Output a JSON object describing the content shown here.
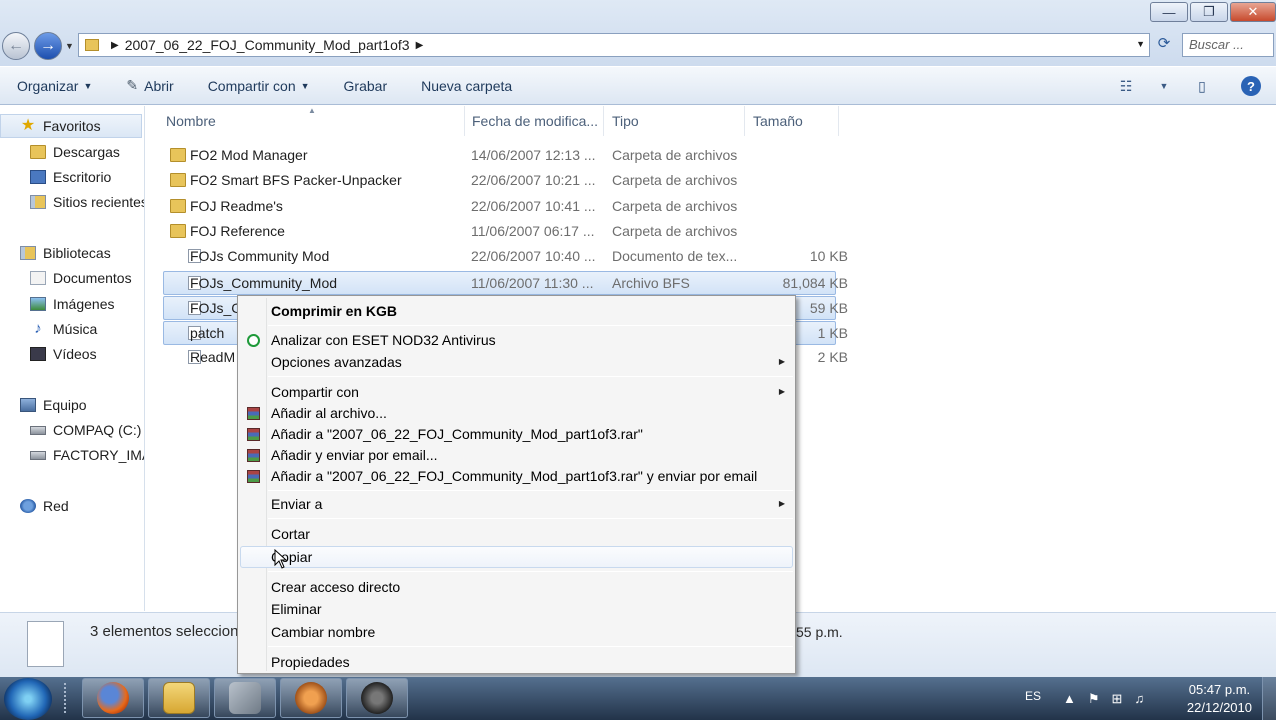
{
  "window": {
    "minimize": "—",
    "maximize": "❐",
    "close": "✕"
  },
  "address": {
    "path": "2007_06_22_FOJ_Community_Mod_part1of3",
    "search_placeholder": "Buscar ..."
  },
  "toolbar": {
    "organize": "Organizar",
    "open": "Abrir",
    "share": "Compartir con",
    "burn": "Grabar",
    "new_folder": "Nueva carpeta"
  },
  "nav": {
    "favorites": "Favoritos",
    "downloads": "Descargas",
    "desktop": "Escritorio",
    "recent": "Sitios recientes",
    "libraries": "Bibliotecas",
    "documents": "Documentos",
    "images": "Imágenes",
    "music": "Música",
    "videos": "Vídeos",
    "computer": "Equipo",
    "drive_c": "COMPAQ (C:)",
    "drive_factory": "FACTORY_IMAGE",
    "network": "Red"
  },
  "columns": {
    "name": "Nombre",
    "date": "Fecha de modifica...",
    "type": "Tipo",
    "size": "Tamaño"
  },
  "files": [
    {
      "name": "FO2 Mod Manager",
      "date": "14/06/2007 12:13 ...",
      "type": "Carpeta de archivos",
      "size": "",
      "kind": "folder",
      "selected": false
    },
    {
      "name": "FO2 Smart BFS Packer-Unpacker",
      "date": "22/06/2007 10:21 ...",
      "type": "Carpeta de archivos",
      "size": "",
      "kind": "folder",
      "selected": false
    },
    {
      "name": "FOJ Readme's",
      "date": "22/06/2007 10:41 ...",
      "type": "Carpeta de archivos",
      "size": "",
      "kind": "folder",
      "selected": false
    },
    {
      "name": "FOJ Reference",
      "date": "11/06/2007 06:17 ...",
      "type": "Carpeta de archivos",
      "size": "",
      "kind": "folder",
      "selected": false
    },
    {
      "name": "FOJs Community Mod",
      "date": "22/06/2007 10:40 ...",
      "type": "Documento de tex...",
      "size": "10 KB",
      "kind": "file",
      "selected": false
    },
    {
      "name": "FOJs_Community_Mod",
      "date": "11/06/2007 11:30 ...",
      "type": "Archivo BFS",
      "size": "81,084 KB",
      "kind": "file",
      "selected": true
    },
    {
      "name": "FOJs_Co",
      "date": "",
      "type": "",
      "size": "59 KB",
      "kind": "file",
      "selected": true
    },
    {
      "name": "patch",
      "date": "",
      "type": "",
      "size": "1 KB",
      "kind": "file",
      "selected": true
    },
    {
      "name": "ReadM",
      "date": "",
      "type": "",
      "size": "2 KB",
      "kind": "file",
      "selected": false
    }
  ],
  "context_menu": {
    "compress": "Comprimir en KGB",
    "eset": "Analizar con ESET NOD32 Antivirus",
    "advanced": "Opciones avanzadas",
    "share": "Compartir con",
    "add_archive": "Añadir al archivo...",
    "add_rar": "Añadir a \"2007_06_22_FOJ_Community_Mod_part1of3.rar\"",
    "add_email": "Añadir y enviar por email...",
    "add_rar_email": "Añadir a \"2007_06_22_FOJ_Community_Mod_part1of3.rar\" y enviar por email",
    "send_to": "Enviar a",
    "cut": "Cortar",
    "copy": "Copiar",
    "shortcut": "Crear acceso directo",
    "delete": "Eliminar",
    "rename": "Cambiar nombre",
    "properties": "Propiedades"
  },
  "details": {
    "count": "3 elementos seleccionados",
    "date_fragment": "55 p.m."
  },
  "taskbar": {
    "lang": "ES",
    "time": "05:47 p.m.",
    "date": "22/12/2010"
  }
}
